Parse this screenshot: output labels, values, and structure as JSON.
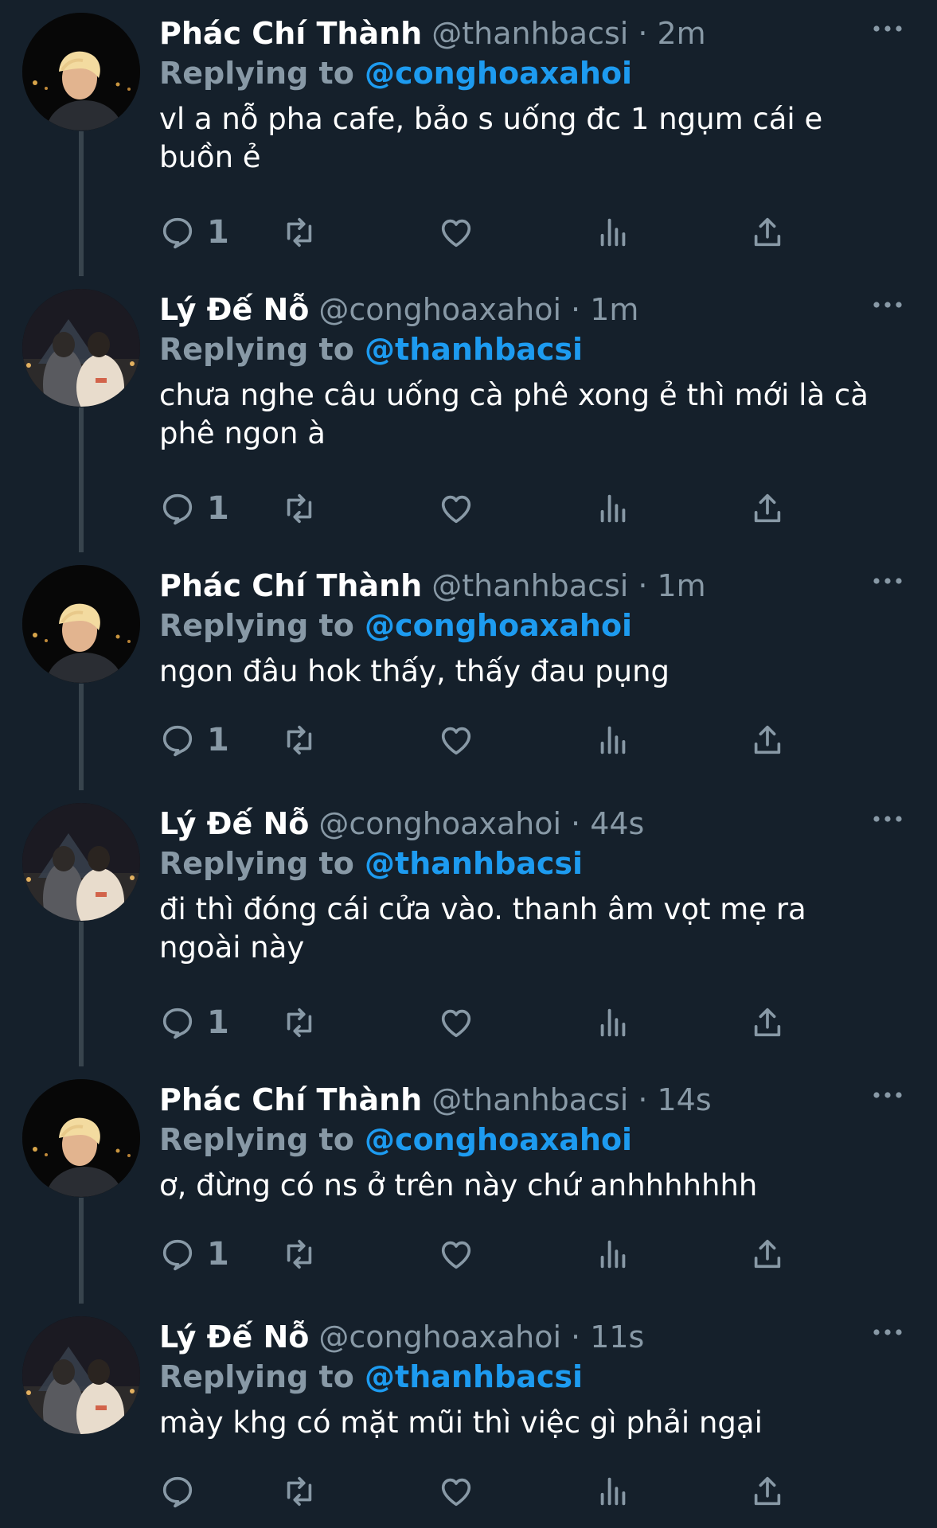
{
  "tweets": [
    {
      "name": "Phác Chí Thành",
      "handle": "@thanhbacsi",
      "time": "· 2m",
      "replying_label": "Replying to",
      "replying_to": "@conghoaxahoi",
      "text": "vl a nỗ pha cafe, bảo s uống đc 1 ngụm cái e buồn ẻ",
      "reply_count": "1",
      "avatar": "blond-boy-night"
    },
    {
      "name": "Lý Đế Nỗ",
      "handle": "@conghoaxahoi",
      "time": "· 1m",
      "replying_label": "Replying to",
      "replying_to": "@thanhbacsi",
      "text": "chưa nghe câu uống cà phê xong ẻ thì mới là cà phê ngon à",
      "reply_count": "1",
      "avatar": "couple-louvre-night"
    },
    {
      "name": "Phác Chí Thành",
      "handle": "@thanhbacsi",
      "time": "· 1m",
      "replying_label": "Replying to",
      "replying_to": "@conghoaxahoi",
      "text": "ngon đâu hok thấy, thấy đau pụng",
      "reply_count": "1",
      "avatar": "blond-boy-night"
    },
    {
      "name": "Lý Đế Nỗ",
      "handle": "@conghoaxahoi",
      "time": "· 44s",
      "replying_label": "Replying to",
      "replying_to": "@thanhbacsi",
      "text": "đi thì đóng cái cửa vào. thanh âm vọt mẹ ra ngoài này",
      "reply_count": "1",
      "avatar": "couple-louvre-night"
    },
    {
      "name": "Phác Chí Thành",
      "handle": "@thanhbacsi",
      "time": "· 14s",
      "replying_label": "Replying to",
      "replying_to": "@conghoaxahoi",
      "text": "ơ, đừng có ns ở trên này chứ anhhhhhhh",
      "reply_count": "1",
      "avatar": "blond-boy-night"
    },
    {
      "name": "Lý Đế Nỗ",
      "handle": "@conghoaxahoi",
      "time": "· 11s",
      "replying_label": "Replying to",
      "replying_to": "@thanhbacsi",
      "text": "mày khg có mặt mũi thì việc gì phải ngại",
      "reply_count": "",
      "avatar": "couple-louvre-night"
    }
  ],
  "icons": {
    "more": "more-dots-icon",
    "reply": "reply-bubble-icon",
    "retweet": "retweet-icon",
    "like": "heart-icon",
    "views": "views-bar-icon",
    "share": "share-icon"
  },
  "colors": {
    "background": "#15202b",
    "text": "#ffffff",
    "muted": "#8899a6",
    "link": "#1d9bf0",
    "thread_line": "#38444d"
  }
}
